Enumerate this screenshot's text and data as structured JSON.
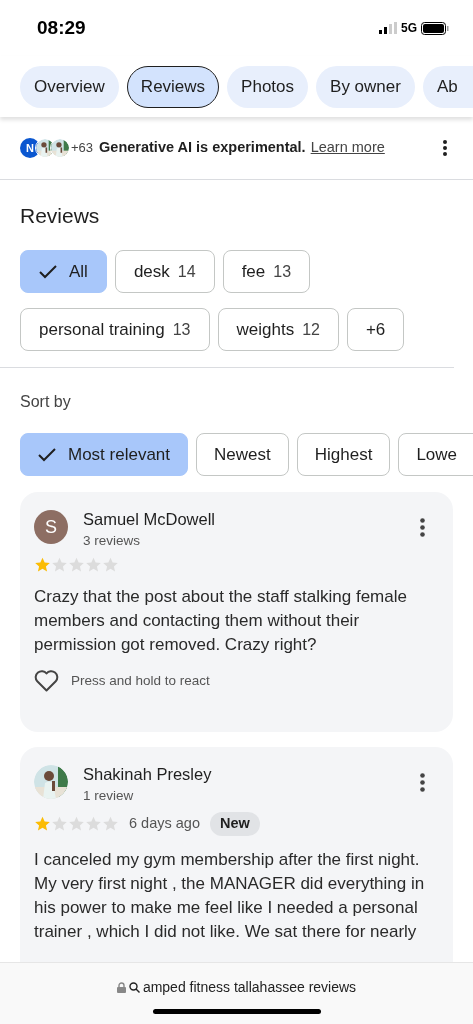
{
  "status_bar": {
    "time": "08:29",
    "network": "5G"
  },
  "tabs": [
    {
      "label": "Overview",
      "selected": false
    },
    {
      "label": "Reviews",
      "selected": true
    },
    {
      "label": "Photos",
      "selected": false
    },
    {
      "label": "By owner",
      "selected": false
    },
    {
      "label": "Ab",
      "selected": false
    }
  ],
  "ai_notice": {
    "avatar_letter": "N",
    "count": "+63",
    "text": "Generative AI is experimental.",
    "link": "Learn more"
  },
  "reviews_heading": "Reviews",
  "filters": [
    {
      "label": "All",
      "selected": true
    },
    {
      "label": "desk",
      "count": "14",
      "selected": false
    },
    {
      "label": "fee",
      "count": "13",
      "selected": false
    },
    {
      "label": "personal training",
      "count": "13",
      "selected": false
    },
    {
      "label": "weights",
      "count": "12",
      "selected": false
    },
    {
      "label": "+6",
      "selected": false
    }
  ],
  "sort_label": "Sort by",
  "sort_options": [
    {
      "label": "Most relevant",
      "selected": true
    },
    {
      "label": "Newest",
      "selected": false
    },
    {
      "label": "Highest",
      "selected": false
    },
    {
      "label": "Lowe",
      "selected": false
    }
  ],
  "reviews": [
    {
      "author": "Samuel McDowell",
      "avatar": {
        "kind": "letter",
        "letter": "S",
        "color": "#8d6e63"
      },
      "meta": "3 reviews",
      "stars": 1,
      "text": "Crazy that the post about the staff stalking female members and contacting them without their permission got removed. Crazy right?",
      "react": "Press and hold to react"
    },
    {
      "author": "Shakinah Presley",
      "meta": "1 review",
      "stars": 1,
      "date": "6 days ago",
      "badge": "New",
      "text": "I canceled my gym membership after the first night. My very first night , the MANAGER did everything in his power to make me feel like I needed a personal trainer , which I did not like. We sat there for nearly"
    }
  ],
  "address_bar": {
    "text": "amped fitness tallahassee reviews"
  }
}
